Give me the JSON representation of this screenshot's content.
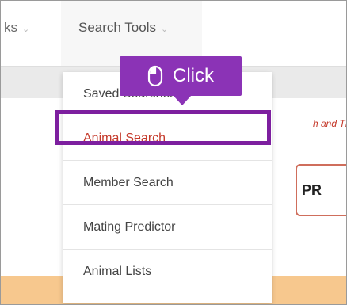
{
  "nav": {
    "partial_label": "ks",
    "search_tools_label": "Search Tools",
    "chevron_icon": "chevron-down-icon"
  },
  "page": {
    "body_text_a": "h and TP",
    "action_button_label": "PR"
  },
  "dropdown": {
    "items": [
      {
        "label": "Saved Searches"
      },
      {
        "label": "Animal Search"
      },
      {
        "label": "Member Search"
      },
      {
        "label": "Mating Predictor"
      },
      {
        "label": "Animal Lists"
      }
    ],
    "active_item": "Animal Search"
  },
  "tooltip": {
    "label": "Click",
    "icon": "mouse-icon"
  },
  "colors": {
    "highlight": "#7d1f9f",
    "tooltip": "#8b33b6",
    "active_text": "#c53a2b",
    "band": "#f7c88e"
  }
}
